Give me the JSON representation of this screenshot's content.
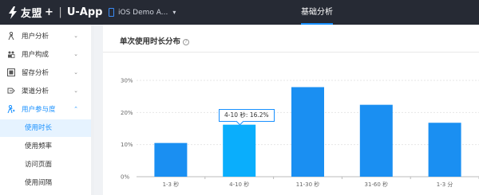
{
  "header": {
    "brand": "友盟",
    "plus": "+",
    "separator": "|",
    "product": "U-App",
    "app_selector": "iOS Demo A...",
    "nav_tab": "基础分析"
  },
  "sidebar": {
    "items": [
      {
        "label": "用户分析",
        "icon": "user-analysis-icon",
        "chevron": "⌄"
      },
      {
        "label": "用户构成",
        "icon": "user-composition-icon",
        "chevron": "⌄"
      },
      {
        "label": "留存分析",
        "icon": "retention-icon",
        "chevron": "⌄"
      },
      {
        "label": "渠道分析",
        "icon": "channel-icon",
        "chevron": "⌄"
      },
      {
        "label": "用户参与度",
        "icon": "engagement-icon",
        "chevron": "⌃"
      }
    ],
    "sub_items": [
      {
        "label": "使用时长"
      },
      {
        "label": "使用频率"
      },
      {
        "label": "访问页面"
      },
      {
        "label": "使用间隔"
      }
    ]
  },
  "panel": {
    "title": "单次使用时长分布",
    "help": "?"
  },
  "tooltip": {
    "text": "4-10 秒: 16.2%"
  },
  "colors": {
    "bar": "#1a8ff2",
    "bar_highlight": "#0aaefc",
    "accent": "#1890ff",
    "topbar": "#262a34"
  },
  "chart_data": {
    "type": "bar",
    "categories": [
      "1-3 秒",
      "4-10 秒",
      "11-30 秒",
      "31-60 秒",
      "1-3 分"
    ],
    "values": [
      10.5,
      16.2,
      27.9,
      22.4,
      16.8
    ],
    "ylim": [
      0,
      30
    ],
    "yticks": [
      "0%",
      "10%",
      "20%",
      "30%"
    ],
    "highlighted_index": 1,
    "grid": true
  }
}
